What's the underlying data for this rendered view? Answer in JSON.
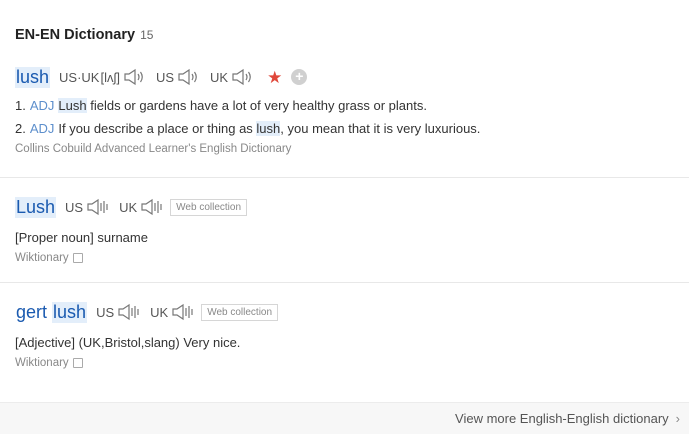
{
  "header": {
    "title": "EN-EN Dictionary",
    "count": "15"
  },
  "entries": [
    {
      "word": "lush",
      "us_uk": "US·UK",
      "phonetic": "[lʌʃ]",
      "us": "US",
      "uk": "UK",
      "defs": [
        {
          "num": "1.",
          "pos": "ADJ",
          "hl": "Lush",
          "rest": " fields or gardens have a lot of very healthy grass or plants."
        },
        {
          "num": "2.",
          "pos": "ADJ",
          "pre": "If you describe a place or thing as ",
          "hl": "lush",
          "rest": ", you mean that it is very luxurious."
        }
      ],
      "source": "Collins Cobuild Advanced Learner's English Dictionary"
    },
    {
      "word": "Lush",
      "us": "US",
      "uk": "UK",
      "badge": "Web collection",
      "def": "[Proper noun] surname",
      "source": "Wiktionary"
    },
    {
      "word_a": "gert",
      "word_b": "lush",
      "us": "US",
      "uk": "UK",
      "badge": "Web collection",
      "def": "[Adjective] (UK,Bristol,slang) Very nice.",
      "source": "Wiktionary"
    }
  ],
  "footer": {
    "more": "View more English-English dictionary"
  },
  "colors": {
    "accent": "#1a5ab0",
    "highlight": "#e3eefa",
    "star": "#e0473a"
  },
  "icons": {
    "speaker": "speaker-icon",
    "star": "star-icon",
    "add": "add-icon",
    "copy": "copy-icon",
    "chevron": "chevron-right-icon"
  }
}
